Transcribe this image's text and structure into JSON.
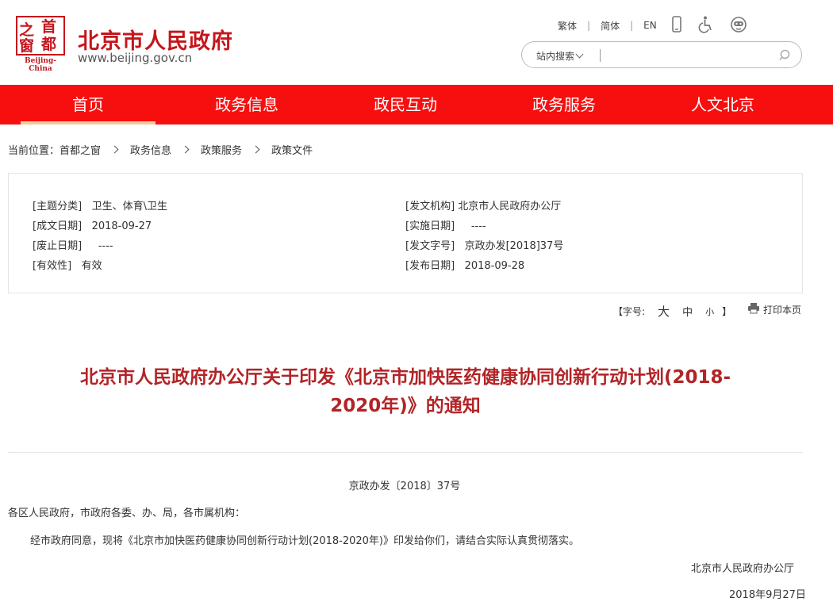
{
  "header": {
    "seal": {
      "c1": "之",
      "c2": "首",
      "c3": "窗",
      "c4": "都",
      "en": "Beijing-China"
    },
    "site_name": "北京市人民政府",
    "site_url": "www.beijing.gov.cn",
    "top_links": [
      "繁体",
      "简体",
      "EN"
    ],
    "tool_icons": [
      "mobile-icon",
      "accessibility-icon",
      "robot-icon"
    ],
    "search": {
      "scope": "站内搜索",
      "placeholder": ""
    }
  },
  "nav": {
    "items": [
      "首页",
      "政务信息",
      "政民互动",
      "政务服务",
      "人文北京"
    ],
    "active_index": 0,
    "colors": {
      "bar": "#f70f0f",
      "active_underline": "#f6c99a"
    }
  },
  "breadcrumb": {
    "prefix": "当前位置：",
    "items": [
      "首都之窗",
      "政务信息",
      "政策服务",
      "政策文件"
    ]
  },
  "meta": {
    "left": [
      {
        "label": "[主题分类]",
        "value": "卫生、体育\\卫生"
      },
      {
        "label": "[成文日期]",
        "value": "2018-09-27"
      },
      {
        "label": "[废止日期]",
        "value": "----"
      },
      {
        "label": "[有效性]",
        "value": "有效"
      }
    ],
    "right": [
      {
        "label": "[发文机构]",
        "value": "北京市人民政府办公厅"
      },
      {
        "label": "[实施日期]",
        "value": "----"
      },
      {
        "label": "[发文字号]",
        "value": "京政办发[2018]37号"
      },
      {
        "label": "[发布日期]",
        "value": "2018-09-28"
      }
    ]
  },
  "tools": {
    "font_label": "【字号:",
    "sizes": [
      "大",
      "中",
      "小"
    ],
    "font_close": "】",
    "print_label": "打印本页"
  },
  "article": {
    "title_line1": "北京市人民政府办公厅关于印发《北京市加快医药健康协同创新行动计划(2018-",
    "title_line2": "2020年)》的通知",
    "doc_number": "京政办发〔2018〕37号",
    "salutation": "各区人民政府，市政府各委、办、局，各市属机构：",
    "body": "经市政府同意，现将《北京市加快医药健康协同创新行动计划(2018-2020年)》印发给你们，请结合实际认真贯彻落实。",
    "issuer": "北京市人民政府办公厅",
    "date": "2018年9月27日",
    "title_color": "#b22427"
  }
}
